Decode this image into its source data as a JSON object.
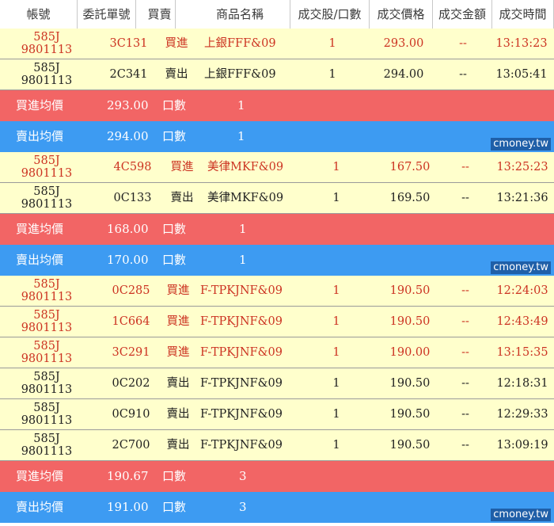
{
  "header": [
    "帳號",
    "委託單號",
    "買賣",
    "商品名稱",
    "成交股/口數",
    "成交價格",
    "成交金額",
    "成交時間"
  ],
  "summary_labels": {
    "buy": "買進均價",
    "sell": "賣出均價",
    "lots": "口數"
  },
  "watermark": "cmoney.tw",
  "groups": [
    {
      "trades": [
        {
          "acct1": "585J",
          "acct2": "9801113",
          "order": "3C131",
          "side": "買進",
          "type": "buy",
          "product": "上銀FFF&09",
          "qty": "1",
          "price": "293.00",
          "amount": "--",
          "time": "13:13:23"
        },
        {
          "acct1": "585J",
          "acct2": "9801113",
          "order": "2C341",
          "side": "賣出",
          "type": "sell",
          "product": "上銀FFF&09",
          "qty": "1",
          "price": "294.00",
          "amount": "--",
          "time": "13:05:41"
        }
      ],
      "buy_avg": "293.00",
      "buy_lots": "1",
      "sell_avg": "294.00",
      "sell_lots": "1"
    },
    {
      "trades": [
        {
          "acct1": "585J",
          "acct2": "9801113",
          "order": "4C598",
          "side": "買進",
          "type": "buy",
          "product": "美律MKF&09",
          "qty": "1",
          "price": "167.50",
          "amount": "--",
          "time": "13:25:23"
        },
        {
          "acct1": "585J",
          "acct2": "9801113",
          "order": "0C133",
          "side": "賣出",
          "type": "sell",
          "product": "美律MKF&09",
          "qty": "1",
          "price": "169.50",
          "amount": "--",
          "time": "13:21:36"
        }
      ],
      "buy_avg": "168.00",
      "buy_lots": "1",
      "sell_avg": "170.00",
      "sell_lots": "1"
    },
    {
      "trades": [
        {
          "acct1": "585J",
          "acct2": "9801113",
          "order": "0C285",
          "side": "買進",
          "type": "buy",
          "product": "F-TPKJNF&09",
          "qty": "1",
          "price": "190.50",
          "amount": "--",
          "time": "12:24:03"
        },
        {
          "acct1": "585J",
          "acct2": "9801113",
          "order": "1C664",
          "side": "買進",
          "type": "buy",
          "product": "F-TPKJNF&09",
          "qty": "1",
          "price": "190.50",
          "amount": "--",
          "time": "12:43:49"
        },
        {
          "acct1": "585J",
          "acct2": "9801113",
          "order": "3C291",
          "side": "買進",
          "type": "buy",
          "product": "F-TPKJNF&09",
          "qty": "1",
          "price": "190.00",
          "amount": "--",
          "time": "13:15:35"
        },
        {
          "acct1": "585J",
          "acct2": "9801113",
          "order": "0C202",
          "side": "賣出",
          "type": "sell",
          "product": "F-TPKJNF&09",
          "qty": "1",
          "price": "190.50",
          "amount": "--",
          "time": "12:18:31"
        },
        {
          "acct1": "585J",
          "acct2": "9801113",
          "order": "0C910",
          "side": "賣出",
          "type": "sell",
          "product": "F-TPKJNF&09",
          "qty": "1",
          "price": "190.50",
          "amount": "--",
          "time": "12:29:33"
        },
        {
          "acct1": "585J",
          "acct2": "9801113",
          "order": "2C700",
          "side": "賣出",
          "type": "sell",
          "product": "F-TPKJNF&09",
          "qty": "1",
          "price": "190.50",
          "amount": "--",
          "time": "13:09:19"
        }
      ],
      "buy_avg": "190.67",
      "buy_lots": "3",
      "sell_avg": "191.00",
      "sell_lots": "3"
    }
  ]
}
